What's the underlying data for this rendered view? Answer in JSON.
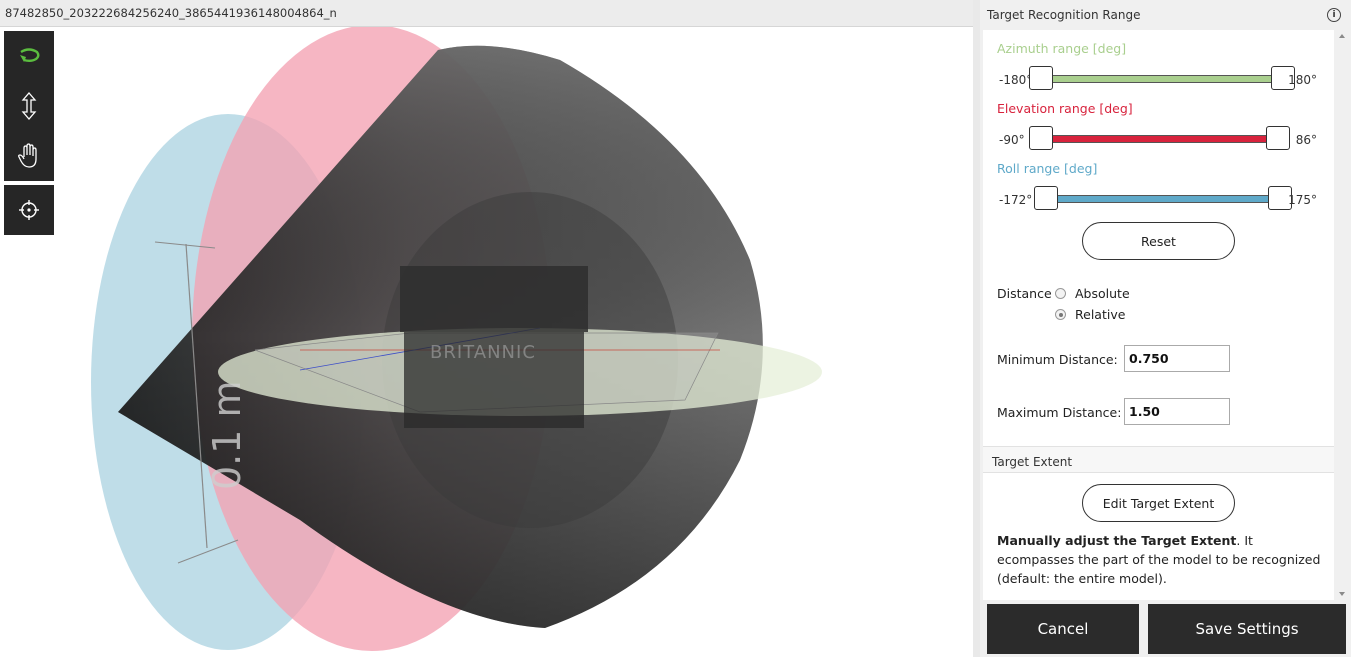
{
  "viewport": {
    "title": "87482850_203222684256240_3865441936148004864_n",
    "scale_label": "0.1 m",
    "model_label": "BRITANNIC",
    "tools": [
      "rotate-icon",
      "zoom-icon",
      "pan-icon",
      "focus-icon"
    ],
    "colors": {
      "azimuth_disc": "#a9d1e0",
      "elevation_disc": "#f4a2b2",
      "cone": "#555555",
      "roll_disc": "#e6efd8",
      "rotate_icon": "#5bbd3f"
    }
  },
  "panel": {
    "title": "Target Recognition Range",
    "info_icon": "i",
    "azimuth": {
      "label": "Azimuth range [deg]",
      "min": "-180°",
      "max": "180°",
      "color": "#a9cf8e",
      "low": -180,
      "high": 180,
      "limit_low": -180,
      "limit_high": 180
    },
    "elevation": {
      "label": "Elevation range [deg]",
      "min": "-90°",
      "max": "86°",
      "color": "#d8233d",
      "low": -90,
      "high": 86,
      "limit_low": -90,
      "limit_high": 90
    },
    "roll": {
      "label": "Roll range [deg]",
      "min": "-172°",
      "max": "175°",
      "color": "#5fa9c9",
      "low": -172,
      "high": 175,
      "limit_low": -180,
      "limit_high": 180
    },
    "reset_label": "Reset",
    "distance": {
      "label": "Distance",
      "options": [
        "Absolute",
        "Relative"
      ],
      "selected": "Relative"
    },
    "min_distance": {
      "label": "Minimum Distance:",
      "value": "0.750"
    },
    "max_distance": {
      "label": "Maximum Distance:",
      "value": "1.50"
    },
    "target_extent": {
      "section_title": "Target Extent",
      "button_label": "Edit Target Extent",
      "desc_bold": "Manually adjust the Target Extent",
      "desc_rest": ". It ecompasses the part of the model to be recognized (default: the entire model)."
    }
  },
  "footer": {
    "cancel_label": "Cancel",
    "save_label": "Save Settings"
  }
}
